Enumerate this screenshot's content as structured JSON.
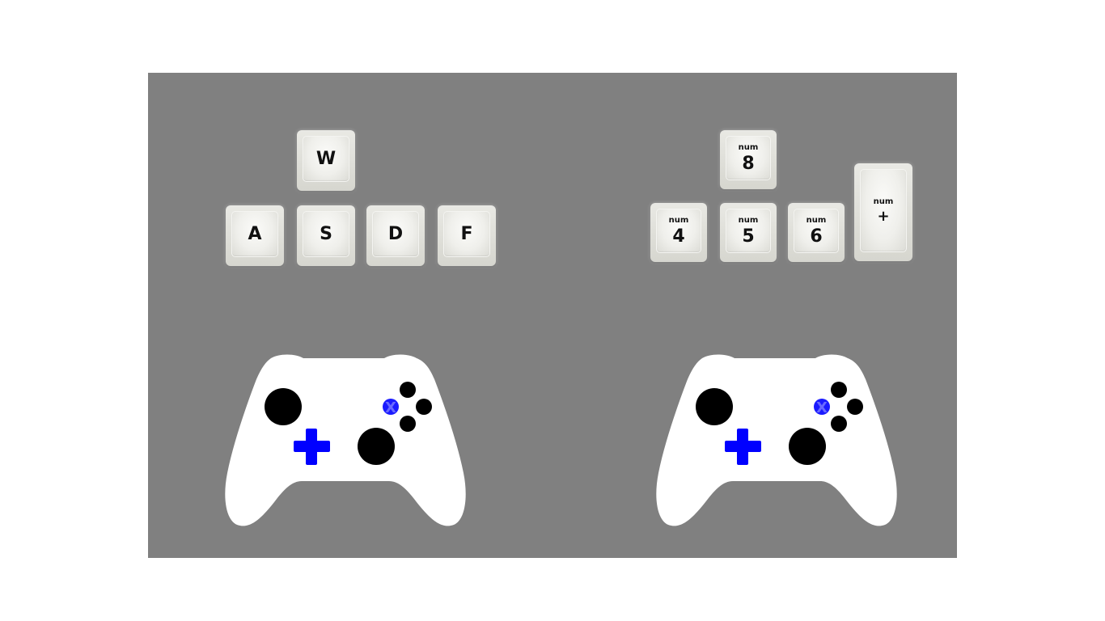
{
  "player1": {
    "keys": {
      "up": "W",
      "left": "A",
      "down": "S",
      "right": "D",
      "action": "F"
    },
    "controller": {
      "highlight_button": "X",
      "highlight_color": "#1a1aff"
    }
  },
  "player2": {
    "keys": {
      "up_prefix": "num",
      "up": "8",
      "left_prefix": "num",
      "left": "4",
      "down_prefix": "num",
      "down": "5",
      "right_prefix": "num",
      "right": "6",
      "action_prefix": "num",
      "action": "+"
    },
    "controller": {
      "highlight_button": "X",
      "highlight_color": "#1a1aff"
    }
  },
  "colors": {
    "background": "#808080",
    "controller_body": "#ffffff",
    "stick": "#000000",
    "dpad": "#0000ff"
  },
  "icons": [
    "gamepad-icon",
    "dpad-icon",
    "keycap"
  ]
}
